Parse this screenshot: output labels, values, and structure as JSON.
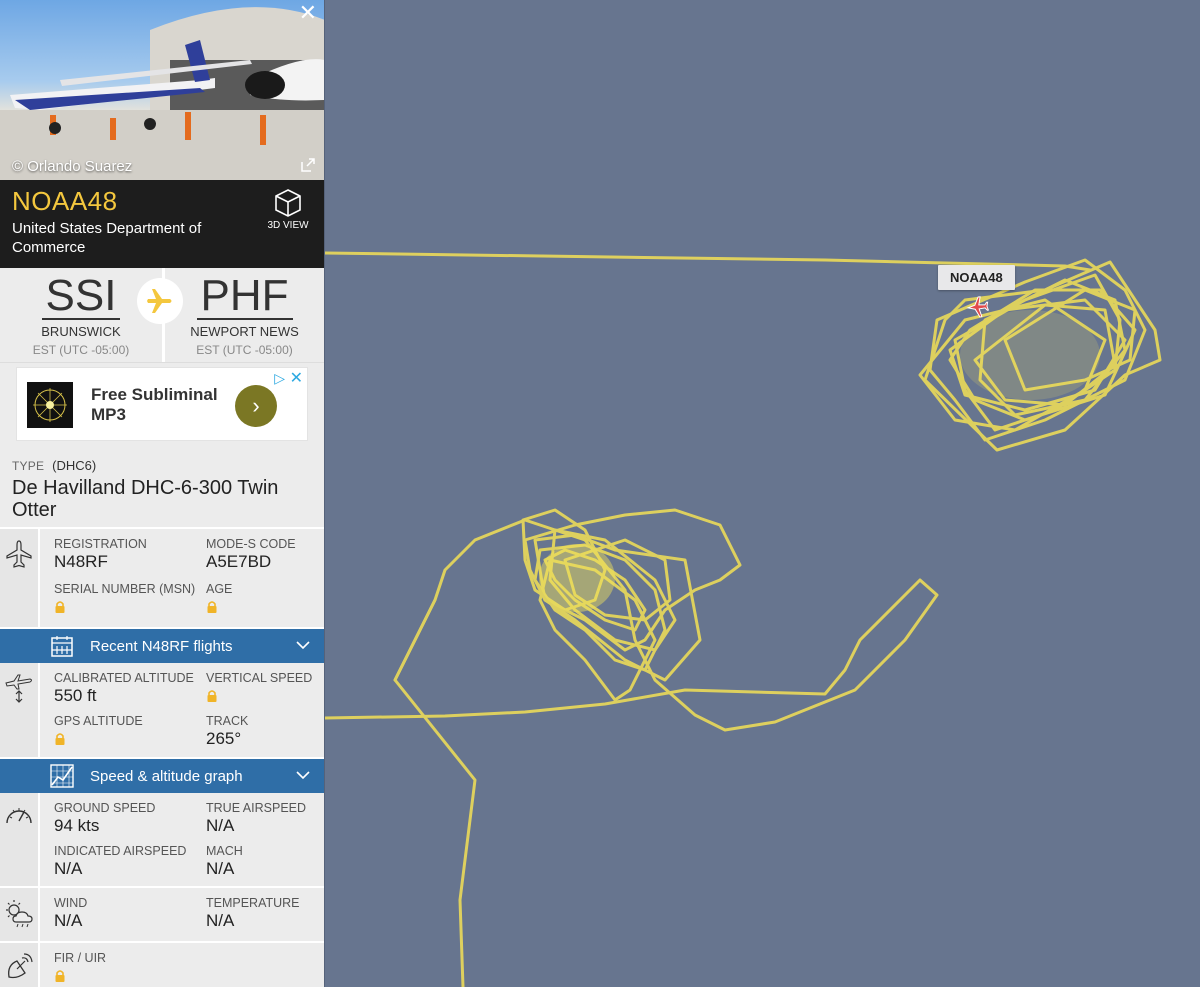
{
  "photo": {
    "credit": "© Orlando Suarez",
    "close_icon": "close-icon",
    "expand_icon": "expand-icon"
  },
  "header": {
    "callsign": "NOAA48",
    "airline": "United States Department of Commerce",
    "view3d_label": "3D VIEW"
  },
  "route": {
    "origin": {
      "iata": "SSI",
      "city": "BRUNSWICK",
      "tz": "EST (UTC -05:00)"
    },
    "destination": {
      "iata": "PHF",
      "city": "NEWPORT NEWS",
      "tz": "EST (UTC -05:00)"
    }
  },
  "ad": {
    "text_line1": "Free Subliminal",
    "text_line2": "MP3",
    "go": "›"
  },
  "type": {
    "label": "TYPE",
    "code": "(DHC6)",
    "name": "De Havilland DHC-6-300 Twin Otter"
  },
  "registration": {
    "registration_label": "REGISTRATION",
    "registration_value": "N48RF",
    "modes_label": "MODE-S CODE",
    "modes_value": "A5E7BD",
    "msn_label": "SERIAL NUMBER (MSN)",
    "age_label": "AGE"
  },
  "recent_flights_bar": {
    "label": "Recent N48RF flights"
  },
  "altitude": {
    "cal_alt_label": "CALIBRATED ALTITUDE",
    "cal_alt_value": "550 ft",
    "vs_label": "VERTICAL SPEED",
    "gps_alt_label": "GPS ALTITUDE",
    "track_label": "TRACK",
    "track_value": "265°"
  },
  "graph_bar": {
    "label": "Speed & altitude graph"
  },
  "speed": {
    "gs_label": "GROUND SPEED",
    "gs_value": "94 kts",
    "tas_label": "TRUE AIRSPEED",
    "tas_value": "N/A",
    "ias_label": "INDICATED AIRSPEED",
    "ias_value": "N/A",
    "mach_label": "MACH",
    "mach_value": "N/A"
  },
  "weather": {
    "wind_label": "WIND",
    "wind_value": "N/A",
    "temp_label": "TEMPERATURE",
    "temp_value": "N/A"
  },
  "fir": {
    "fir_label": "FIR / UIR"
  },
  "map": {
    "aircraft_label": "NOAA48",
    "track_color": "#e8d85a",
    "background_color": "#67758f"
  }
}
